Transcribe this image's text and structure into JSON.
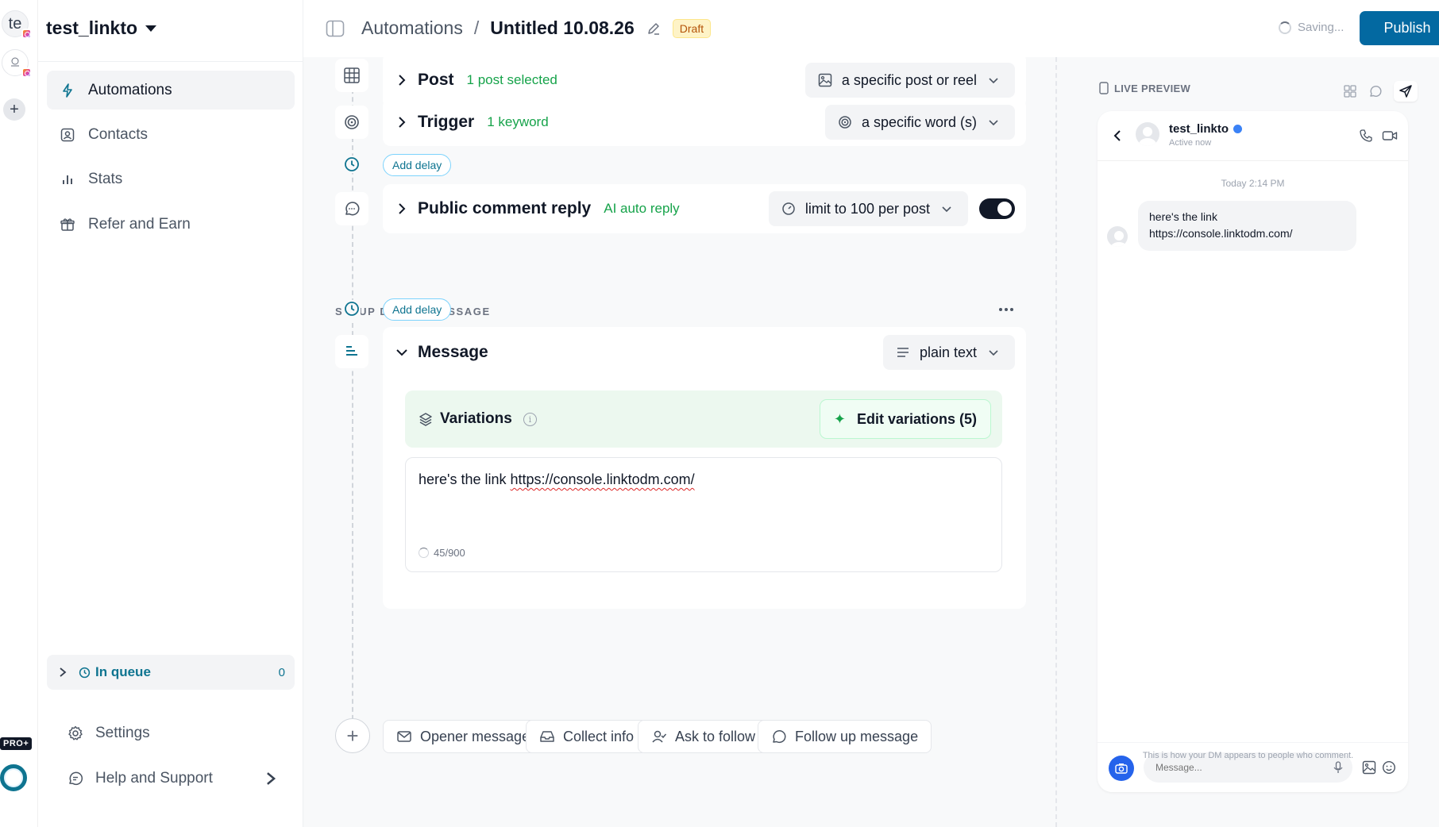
{
  "colors": {
    "accent": "#0369a1",
    "green": "#16a34a",
    "draft": "#fef3c7",
    "teal": "#0e7490"
  },
  "rail": {
    "accounts": [
      {
        "initials": "te"
      },
      {
        "initials": ""
      }
    ],
    "add": "+",
    "pro_badge": "PRO+"
  },
  "sidebar": {
    "workspace": "test_linkto",
    "nav": [
      {
        "label": "Automations",
        "icon": "lightning-icon",
        "active": true
      },
      {
        "label": "Contacts",
        "icon": "contact-icon",
        "active": false
      },
      {
        "label": "Stats",
        "icon": "bar-chart-icon",
        "active": false
      },
      {
        "label": "Refer and Earn",
        "icon": "gift-icon",
        "active": false
      }
    ],
    "queue": {
      "label": "In queue",
      "count": "0"
    },
    "settings": "Settings",
    "help": "Help and Support"
  },
  "header": {
    "section": "Automations",
    "separator": "/",
    "title": "Untitled 10.08.26",
    "status": "Draft",
    "saving": "Saving...",
    "publish": "Publish"
  },
  "flow": {
    "post": {
      "title": "Post",
      "sub": "1 post selected",
      "select": "a specific post or reel"
    },
    "trigger": {
      "title": "Trigger",
      "sub": "1 keyword",
      "select": "a specific word (s)"
    },
    "add_delay": "Add delay",
    "comment_reply": {
      "title": "Public comment reply",
      "sub": "AI auto reply",
      "select": "limit to 100 per post",
      "enabled": true
    },
    "dm_section": "SETUP DIRECT MESSAGE",
    "message": {
      "title": "Message",
      "format": "plain text",
      "variations_label": "Variations",
      "edit_variations": "Edit variations (5)",
      "text_prefix": "here's the link ",
      "text_link": "https://console.linktodm.com/",
      "char_count": "45/900"
    },
    "quick_add": [
      "Opener message",
      "Collect info",
      "Ask to follow",
      "Follow up message"
    ]
  },
  "preview": {
    "heading": "LIVE PREVIEW",
    "account": "test_linkto",
    "status": "Active now",
    "timestamp": "Today 2:14 PM",
    "bubble_line1": "here's the link",
    "bubble_line2": "https://console.linktodm.com/",
    "input_placeholder": "Message...",
    "footer": "This is how your DM appears to people who comment."
  }
}
